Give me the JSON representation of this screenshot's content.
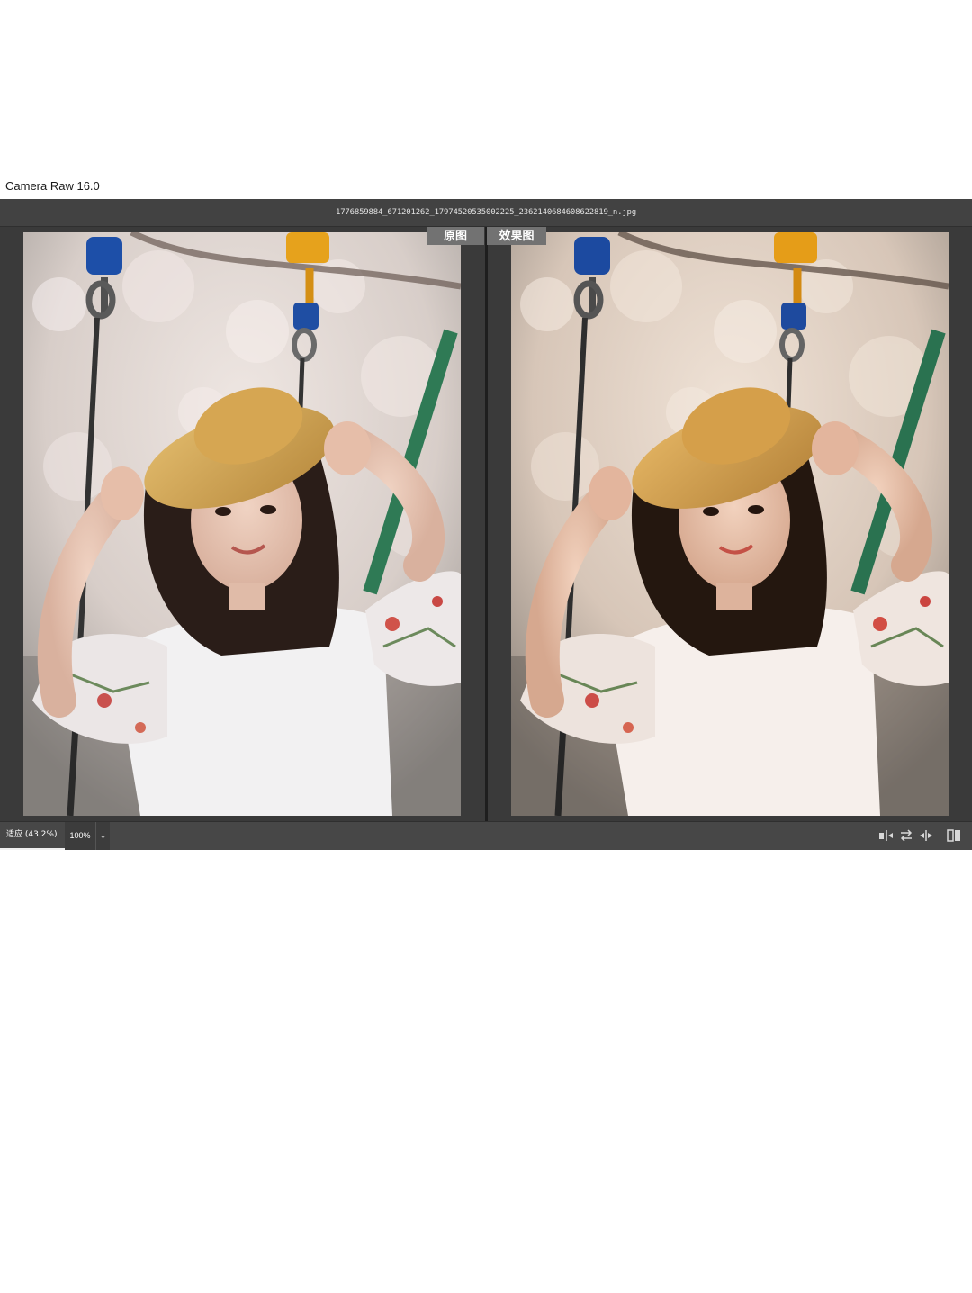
{
  "app": {
    "title": "Camera Raw 16.0"
  },
  "window": {
    "filename": "1776859884_671201262_17974520535002225_2362140684608622819_n.jpg"
  },
  "compare": {
    "before_label": "原图",
    "after_label": "效果图"
  },
  "statusbar": {
    "zoom_fit_label": "适应 (43.2%)",
    "zoom_100_label": "100%",
    "zoom_dropdown_icon": "chevron-down-icon",
    "tools": [
      "swap-before-after-icon",
      "copy-settings-icon",
      "copy-after-to-before-icon",
      "toggle-view-mode-icon"
    ]
  },
  "colors": {
    "ui_bg": "#535353",
    "titlebar": "#424242",
    "canvas": "#3a3a3a",
    "tab": "#727272"
  }
}
